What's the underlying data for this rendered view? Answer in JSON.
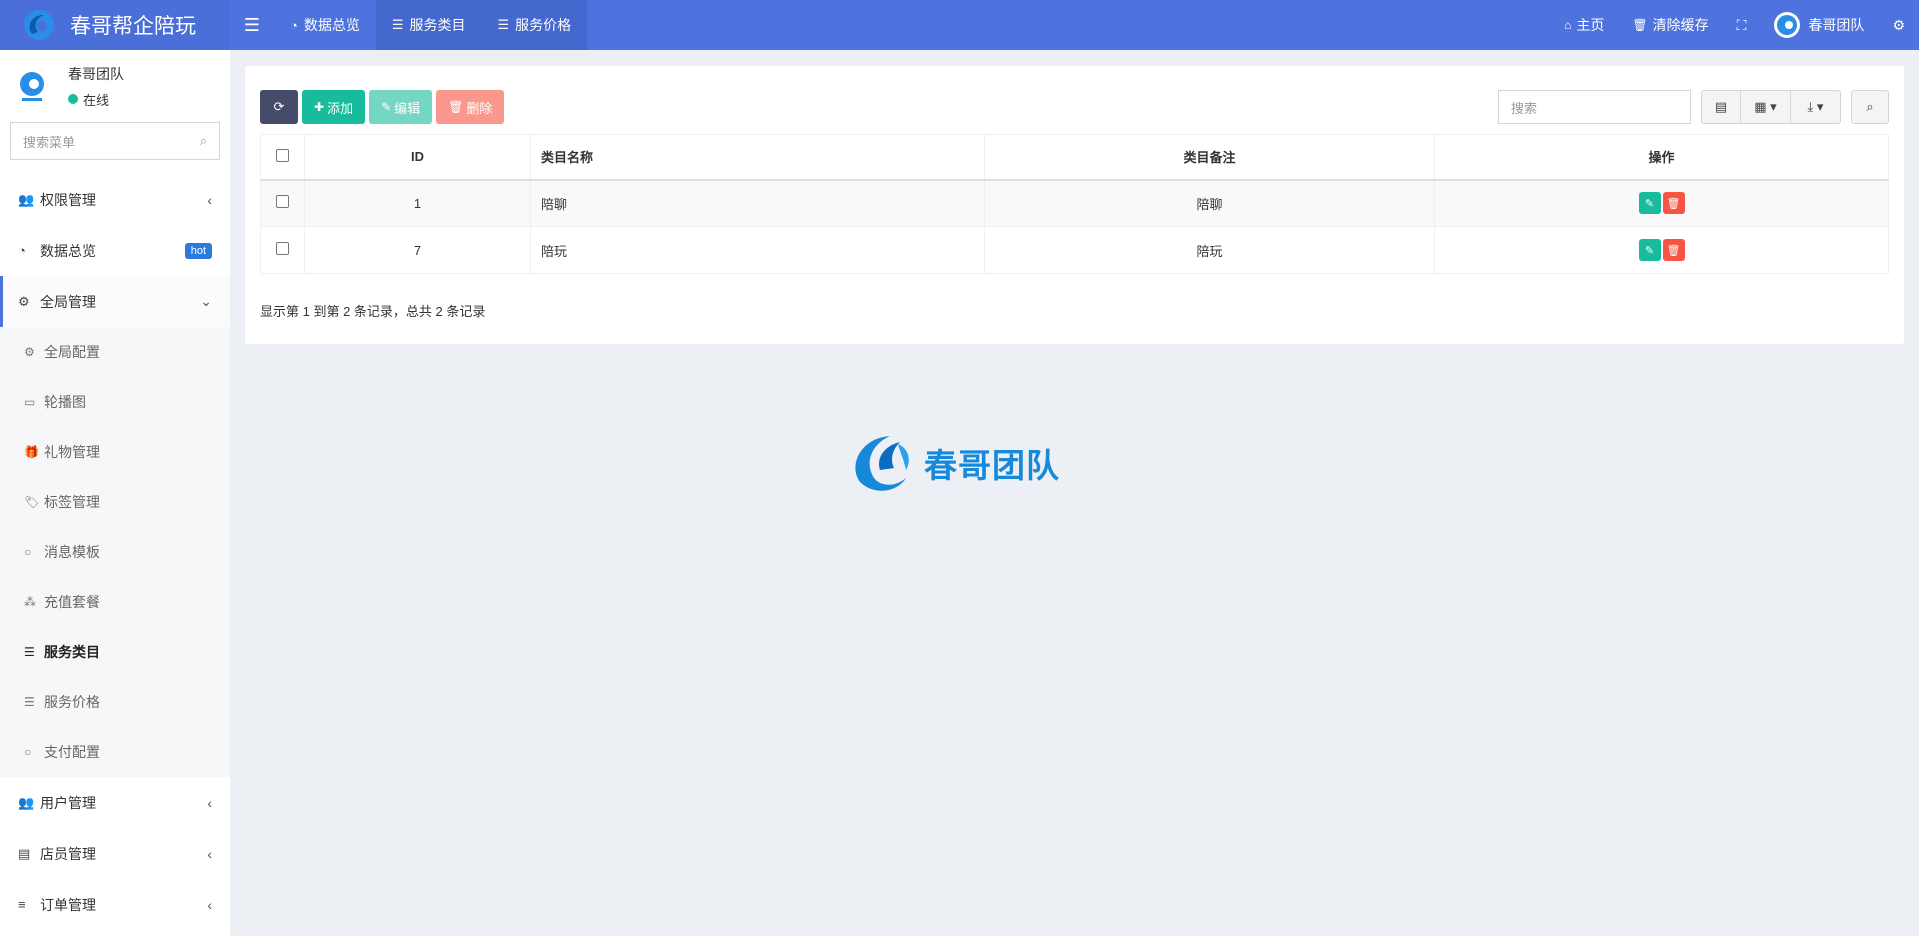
{
  "header": {
    "brand_title": "春哥帮企陪玩",
    "tabs": [
      {
        "label": "数据总览",
        "icon": "dashboard-icon"
      },
      {
        "label": "服务类目",
        "icon": "list-icon"
      },
      {
        "label": "服务价格",
        "icon": "list-icon"
      }
    ],
    "home_label": "主页",
    "clear_cache_label": "清除缓存",
    "user_name": "春哥团队"
  },
  "sidebar": {
    "user": {
      "name": "春哥团队",
      "status": "在线"
    },
    "search_placeholder": "搜索菜单",
    "menu": {
      "auth": "权限管理",
      "dashboard": "数据总览",
      "dashboard_badge": "hot",
      "global": "全局管理",
      "sub": {
        "config": "全局配置",
        "banner": "轮播图",
        "gift": "礼物管理",
        "tag": "标签管理",
        "msg": "消息模板",
        "recharge": "充值套餐",
        "category": "服务类目",
        "price": "服务价格",
        "pay": "支付配置"
      },
      "users": "用户管理",
      "staff": "店员管理",
      "orders": "订单管理"
    }
  },
  "toolbar": {
    "add": "添加",
    "edit": "编辑",
    "delete": "删除",
    "search_placeholder": "搜索"
  },
  "table": {
    "headers": {
      "id": "ID",
      "name": "类目名称",
      "note": "类目备注",
      "op": "操作"
    },
    "rows": [
      {
        "id": "1",
        "name": "陪聊",
        "note": "陪聊"
      },
      {
        "id": "7",
        "name": "陪玩",
        "note": "陪玩"
      }
    ],
    "pagination_info": "显示第 1 到第 2 条记录，总共 2 条记录"
  },
  "watermark": {
    "text": "春哥团队"
  }
}
